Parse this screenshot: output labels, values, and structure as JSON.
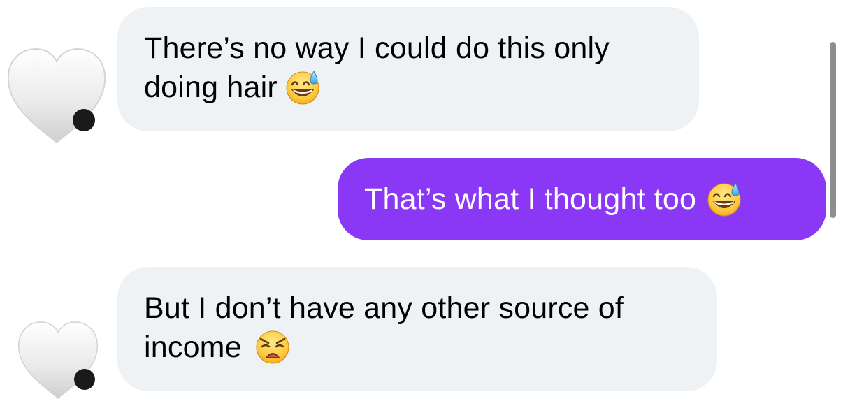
{
  "conversation": {
    "messages": [
      {
        "direction": "incoming",
        "line1": "There’s no way I could do this only",
        "line2": "doing hair",
        "emoji": "grinning-face-with-sweat-icon"
      },
      {
        "direction": "outgoing",
        "line1": "That’s what I thought too",
        "emoji": "grinning-face-with-sweat-icon"
      },
      {
        "direction": "incoming",
        "line1": "But I don’t have any other source of",
        "line2": "income",
        "emoji": "weary-face-icon"
      }
    ],
    "avatar_icon": "white-heart-icon"
  },
  "colors": {
    "incoming_bubble": "#eff2f4",
    "outgoing_bubble": "#8a38f5",
    "incoming_text": "#000000",
    "outgoing_text": "#ffffff",
    "scrollbar": "#8e8e8e"
  }
}
